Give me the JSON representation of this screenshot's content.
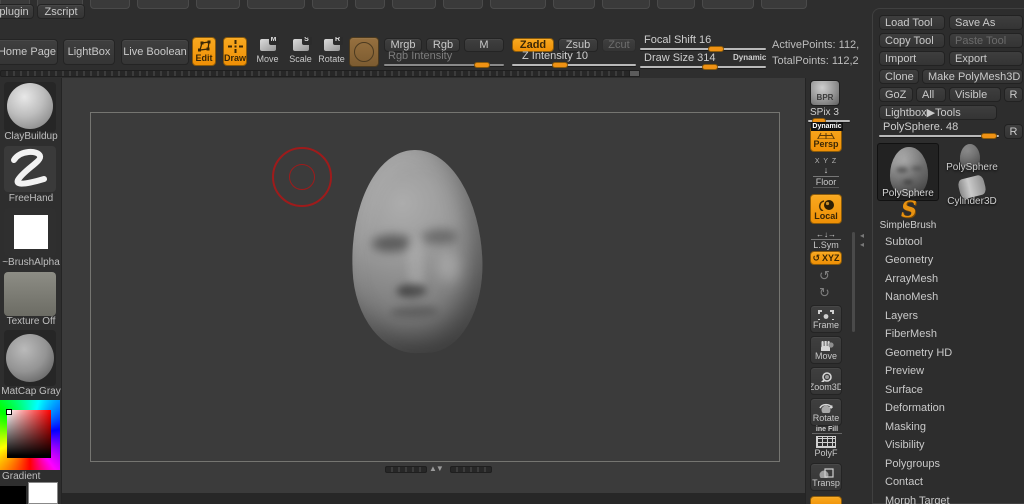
{
  "colors": {
    "accent": "#f09006",
    "handle": "#ef9214",
    "cursor_red": "#9e1b1b",
    "canvas_bg": "#3b3b3b"
  },
  "menubar": {
    "plugin": "plugin",
    "zscript": "Zscript"
  },
  "toolbar": {
    "home_page": "Home Page",
    "lightbox": "LightBox",
    "live_boolean": "Live Boolean",
    "edit": "Edit",
    "draw": "Draw",
    "move": "Move",
    "move_badge": "M",
    "scale": "Scale",
    "scale_badge": "S",
    "rotate": "Rotate",
    "rotate_badge": "R",
    "mrgb": "Mrgb",
    "rgb": "Rgb",
    "m": "M",
    "zadd": "Zadd",
    "zsub": "Zsub",
    "zcut": "Zcut",
    "rgb_intensity": "Rgb Intensity",
    "z_intensity": "Z Intensity 10",
    "focal_shift": "Focal Shift 16",
    "draw_size": "Draw Size 314",
    "dynamic": "Dynamic",
    "active_points": "ActivePoints: 112,",
    "total_points": "TotalPoints: 112,2"
  },
  "left_sidebar": {
    "brush": "ClayBuildup",
    "stroke": "FreeHand",
    "alpha": "~BrushAlpha",
    "texture": "Texture Off",
    "material": "MatCap Gray",
    "gradient": "Gradient"
  },
  "right_shelf": {
    "bpr": "BPR",
    "spix": "SPix 3",
    "dynamic_badge": "Dynamic",
    "persp": "Persp",
    "floor_axes": "X Y Z",
    "floor": "Floor",
    "local": "Local",
    "lsym": "L.Sym",
    "xyz": "XYZ",
    "frame": "Frame",
    "move": "Move",
    "zoom3d": "Zoom3D",
    "rotate": "Rotate",
    "linefill": "ine Fill",
    "polyf": "PolyF",
    "transp": "Transp"
  },
  "tool_panel": {
    "load_tool": "Load Tool",
    "save_as": "Save As",
    "copy_tool": "Copy Tool",
    "paste_tool": "Paste Tool",
    "import": "Import",
    "export": "Export",
    "clone": "Clone",
    "make_polymesh3d": "Make PolyMesh3D",
    "goz": "GoZ",
    "all": "All",
    "visible": "Visible",
    "r": "R",
    "lightbox_tools": "Lightbox▶Tools",
    "polysphere_slider": "PolySphere. 48",
    "slider_r": "R",
    "active_tool": "PolySphere",
    "recent_polysphere": "PolySphere",
    "recent_cylinder": "Cylinder3D",
    "simple_brush": "SimpleBrush",
    "simple_brush_glyph": "S",
    "sections": [
      "Subtool",
      "Geometry",
      "ArrayMesh",
      "NanoMesh",
      "Layers",
      "FiberMesh",
      "Geometry HD",
      "Preview",
      "Surface",
      "Deformation",
      "Masking",
      "Visibility",
      "Polygroups",
      "Contact",
      "Morph Target"
    ]
  },
  "icons": {
    "lsym_arrows": "←↓→",
    "spin_ccw": "↺",
    "spin_cw": "↻",
    "tray_up": "▲",
    "tray_down": "▼",
    "scroll_left": "◂",
    "floor_arrow": "↓"
  }
}
